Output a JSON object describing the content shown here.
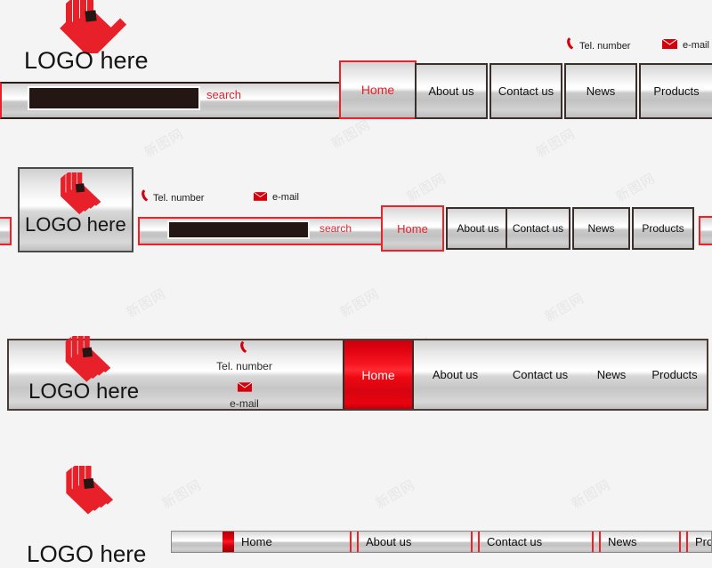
{
  "meta": {
    "brand_red": "#e8202a",
    "metal_light": "#ffffff",
    "metal_dark": "#bdbdbd",
    "input_dark": "#241713",
    "watermark_text": "新图网"
  },
  "logo": {
    "text": "LOGO here",
    "mark_name": "nested-chevron-logo"
  },
  "contact": {
    "phone_label": "Tel. number",
    "email_label": "e-mail",
    "phone_icon": "phone-icon",
    "email_icon": "envelope-icon"
  },
  "search": {
    "label": "search",
    "value": "",
    "placeholder": ""
  },
  "nav": {
    "items": [
      {
        "label": "Home",
        "active": true
      },
      {
        "label": "About us",
        "active": false
      },
      {
        "label": "Contact us",
        "active": false
      },
      {
        "label": "News",
        "active": false
      },
      {
        "label": "Products",
        "active": false
      }
    ]
  },
  "variants": [
    {
      "name": "bar-variant-1-inline-search"
    },
    {
      "name": "bar-variant-2-boxed-logo"
    },
    {
      "name": "bar-variant-3-full-width"
    },
    {
      "name": "bar-variant-4-compact"
    }
  ]
}
